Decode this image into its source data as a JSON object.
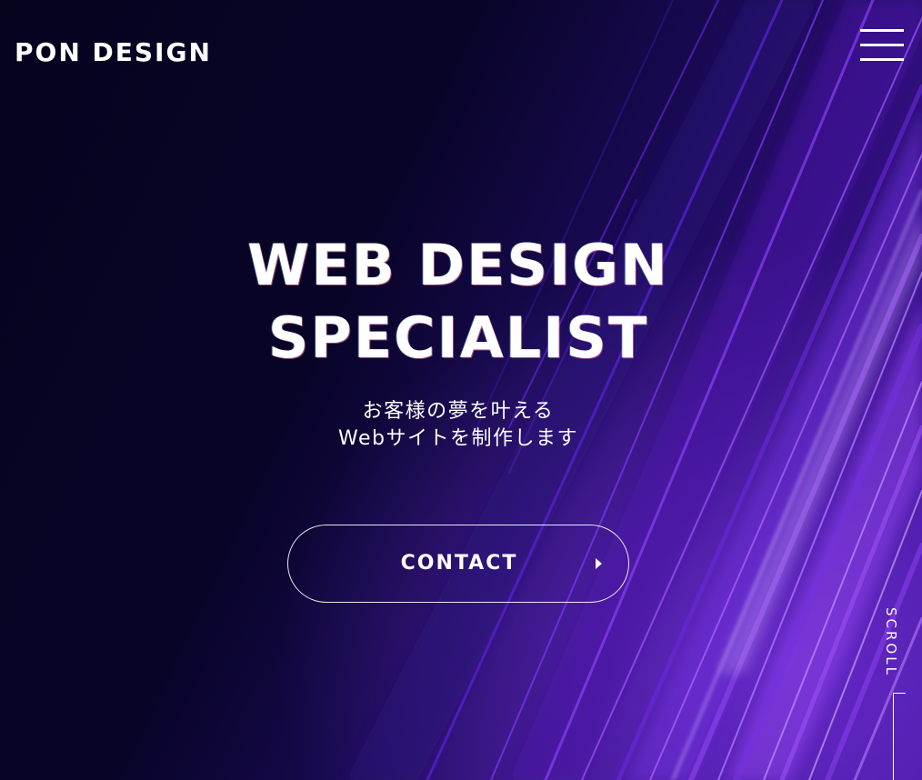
{
  "header": {
    "logo": "PON DESIGN",
    "menu_icon": "hamburger-menu-icon"
  },
  "hero": {
    "title_line1": "WEB DESIGN",
    "title_line2": "SPECIALIST",
    "subtitle_line1": "お客様の夢を叶える",
    "subtitle_line2": "Webサイトを制作します",
    "contact_label": "CONTACT",
    "contact_icon": "triangle-right-icon"
  },
  "scroll": {
    "label": "SCROLL"
  },
  "colors": {
    "background": "#070323",
    "accent_purple": "#7b2fe0",
    "accent_violet": "#a855f7",
    "text": "#ffffff"
  }
}
